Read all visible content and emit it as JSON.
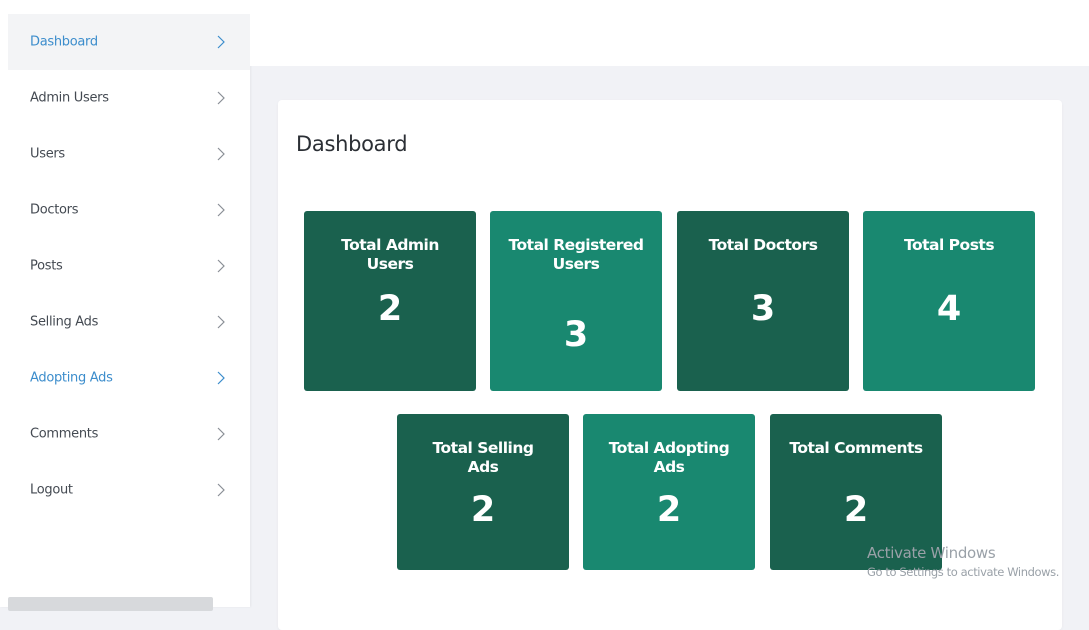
{
  "sidebar": {
    "items": [
      {
        "label": "Dashboard"
      },
      {
        "label": "Admin Users"
      },
      {
        "label": "Users"
      },
      {
        "label": "Doctors"
      },
      {
        "label": "Posts"
      },
      {
        "label": "Selling Ads"
      },
      {
        "label": "Adopting Ads"
      },
      {
        "label": "Comments"
      },
      {
        "label": "Logout"
      }
    ],
    "active_item": "Dashboard",
    "highlight_color": "#3c8dcc"
  },
  "main": {
    "title": "Dashboard",
    "stats": [
      {
        "label": "Total Admin Users",
        "value": "2",
        "color": "#1a614e"
      },
      {
        "label": "Total Registered Users",
        "value": "3",
        "color": "#198870"
      },
      {
        "label": "Total Doctors",
        "value": "3",
        "color": "#1a614e"
      },
      {
        "label": "Total Posts",
        "value": "4",
        "color": "#198870"
      },
      {
        "label": "Total Selling Ads",
        "value": "2",
        "color": "#1a614e"
      },
      {
        "label": "Total Adopting Ads",
        "value": "2",
        "color": "#198870"
      },
      {
        "label": "Total Comments",
        "value": "2",
        "color": "#1a614e"
      }
    ]
  },
  "watermark": {
    "line1": "Activate Windows",
    "line2": "Go to Settings to activate Windows."
  },
  "icons": {
    "sidebar_chevron": "chevron-right-icon"
  }
}
